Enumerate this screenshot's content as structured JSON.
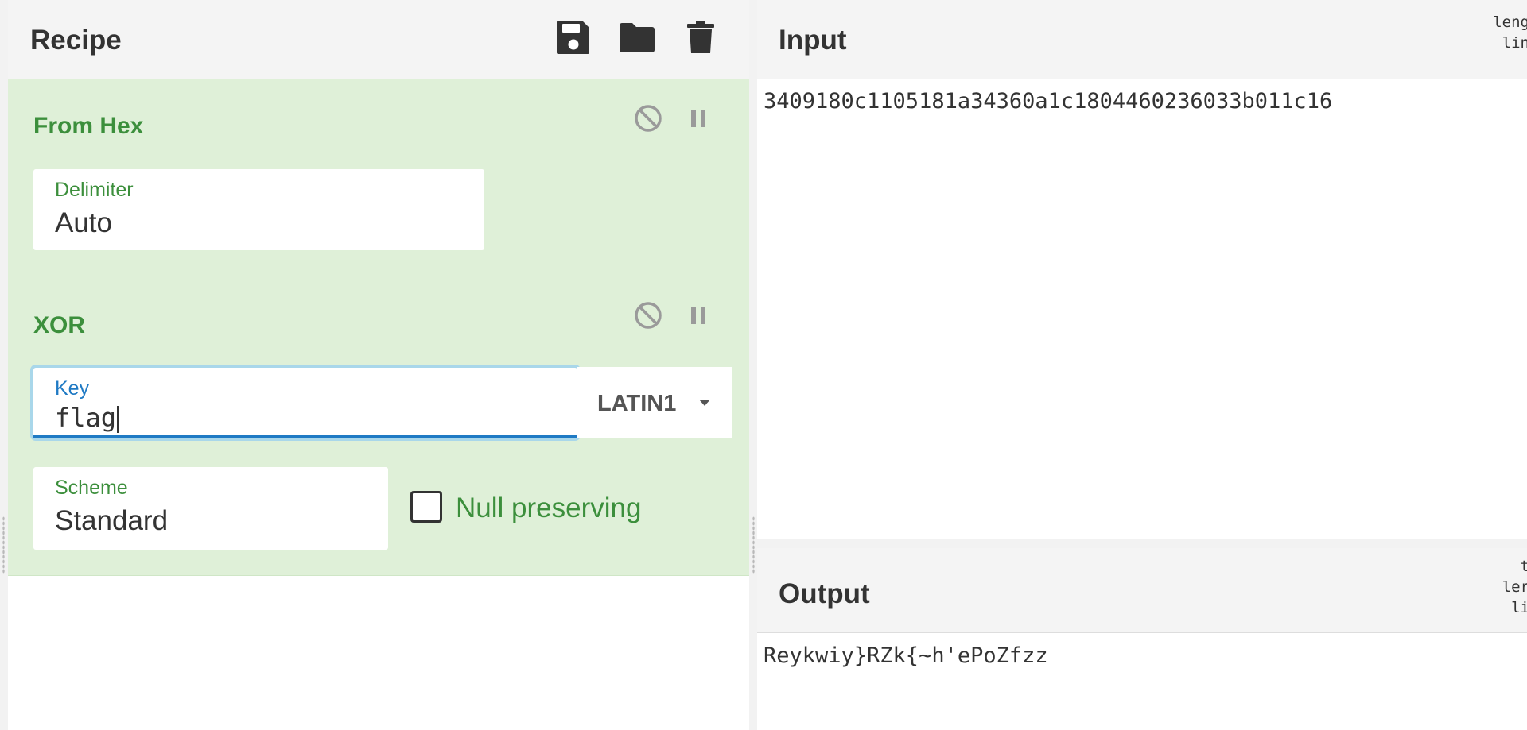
{
  "recipe": {
    "title": "Recipe",
    "toolbar": {
      "save_icon": "save-icon",
      "load_icon": "folder-icon",
      "clear_icon": "trash-icon"
    },
    "operations": [
      {
        "name": "From Hex",
        "disable_icon": "disable-icon",
        "pause_icon": "pause-icon",
        "args": {
          "delimiter_label": "Delimiter",
          "delimiter_value": "Auto"
        }
      },
      {
        "name": "XOR",
        "disable_icon": "disable-icon",
        "pause_icon": "pause-icon",
        "args": {
          "key_label": "Key",
          "key_value": "flag",
          "key_encoding": "LATIN1",
          "scheme_label": "Scheme",
          "scheme_value": "Standard",
          "null_preserving_label": "Null preserving",
          "null_preserving_checked": false
        }
      }
    ]
  },
  "input": {
    "title": "Input",
    "stats_lines": [
      "leng",
      "lin"
    ],
    "text": "3409180c1105181a34360a1c1804460236033b011c16"
  },
  "output": {
    "title": "Output",
    "stats_lines": [
      "t",
      "ler",
      "li"
    ],
    "text": "Reykwiy}RZk{~h'ePoZfzz"
  },
  "colors": {
    "op_background": "#dff0d8",
    "op_title": "#3c8f3c",
    "focus_blue": "#1f7ac4"
  }
}
